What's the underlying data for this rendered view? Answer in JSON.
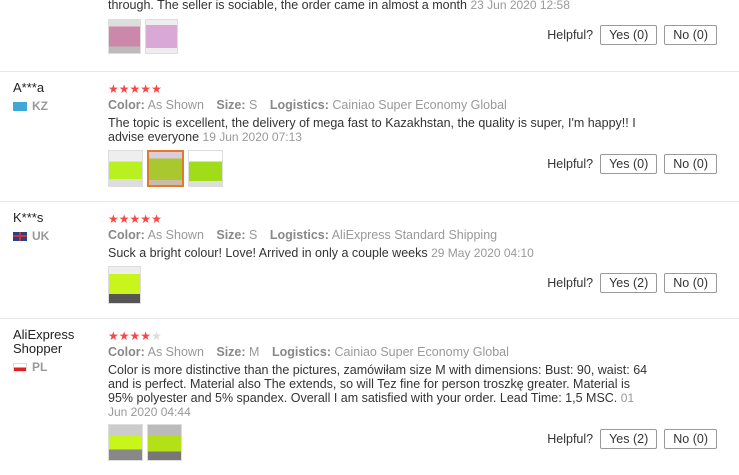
{
  "labels": {
    "color": "Color:",
    "size": "Size:",
    "logistics": "Logistics:",
    "helpful": "Helpful?"
  },
  "reviews": [
    {
      "text": "through. The seller is sociable, the order came in almost a month",
      "date": "23 Jun 2020 12:58",
      "yes": "Yes (0)",
      "no": "No (0)"
    },
    {
      "name": "A***a",
      "country": "KZ",
      "rating": 5,
      "color": "As Shown",
      "size": "S",
      "logistics": "Cainiao Super Economy Global",
      "text": "The topic is excellent, the delivery of mega fast to Kazakhstan, the quality is super, I'm happy!! I advise everyone",
      "date": "19 Jun 2020 07:13",
      "yes": "Yes (0)",
      "no": "No (0)"
    },
    {
      "name": "K***s",
      "country": "UK",
      "rating": 5,
      "color": "As Shown",
      "size": "S",
      "logistics": "AliExpress Standard Shipping",
      "text": "Suck a bright colour! Love! Arrived in only a couple weeks",
      "date": "29 May 2020 04:10",
      "yes": "Yes (2)",
      "no": "No (0)"
    },
    {
      "name": "AliExpress Shopper",
      "country": "PL",
      "rating": 4,
      "color": "As Shown",
      "size": "M",
      "logistics": "Cainiao Super Economy Global",
      "text": "Color is more distinctive than the pictures, zamówiłam size M with dimensions: Bust: 90, waist: 64 and is perfect. Material also The extends, so will Tez fine for person troszkę greater. Material is 95% polyester and 5% spandex. Overall I am satisfied with your order. Lead Time: 1,5 MSC.",
      "date": "01 Jun 2020 04:44",
      "yes": "Yes (2)",
      "no": "No (0)"
    }
  ],
  "colors": {
    "star": "#ff4747",
    "neon": "#c8f51a"
  }
}
